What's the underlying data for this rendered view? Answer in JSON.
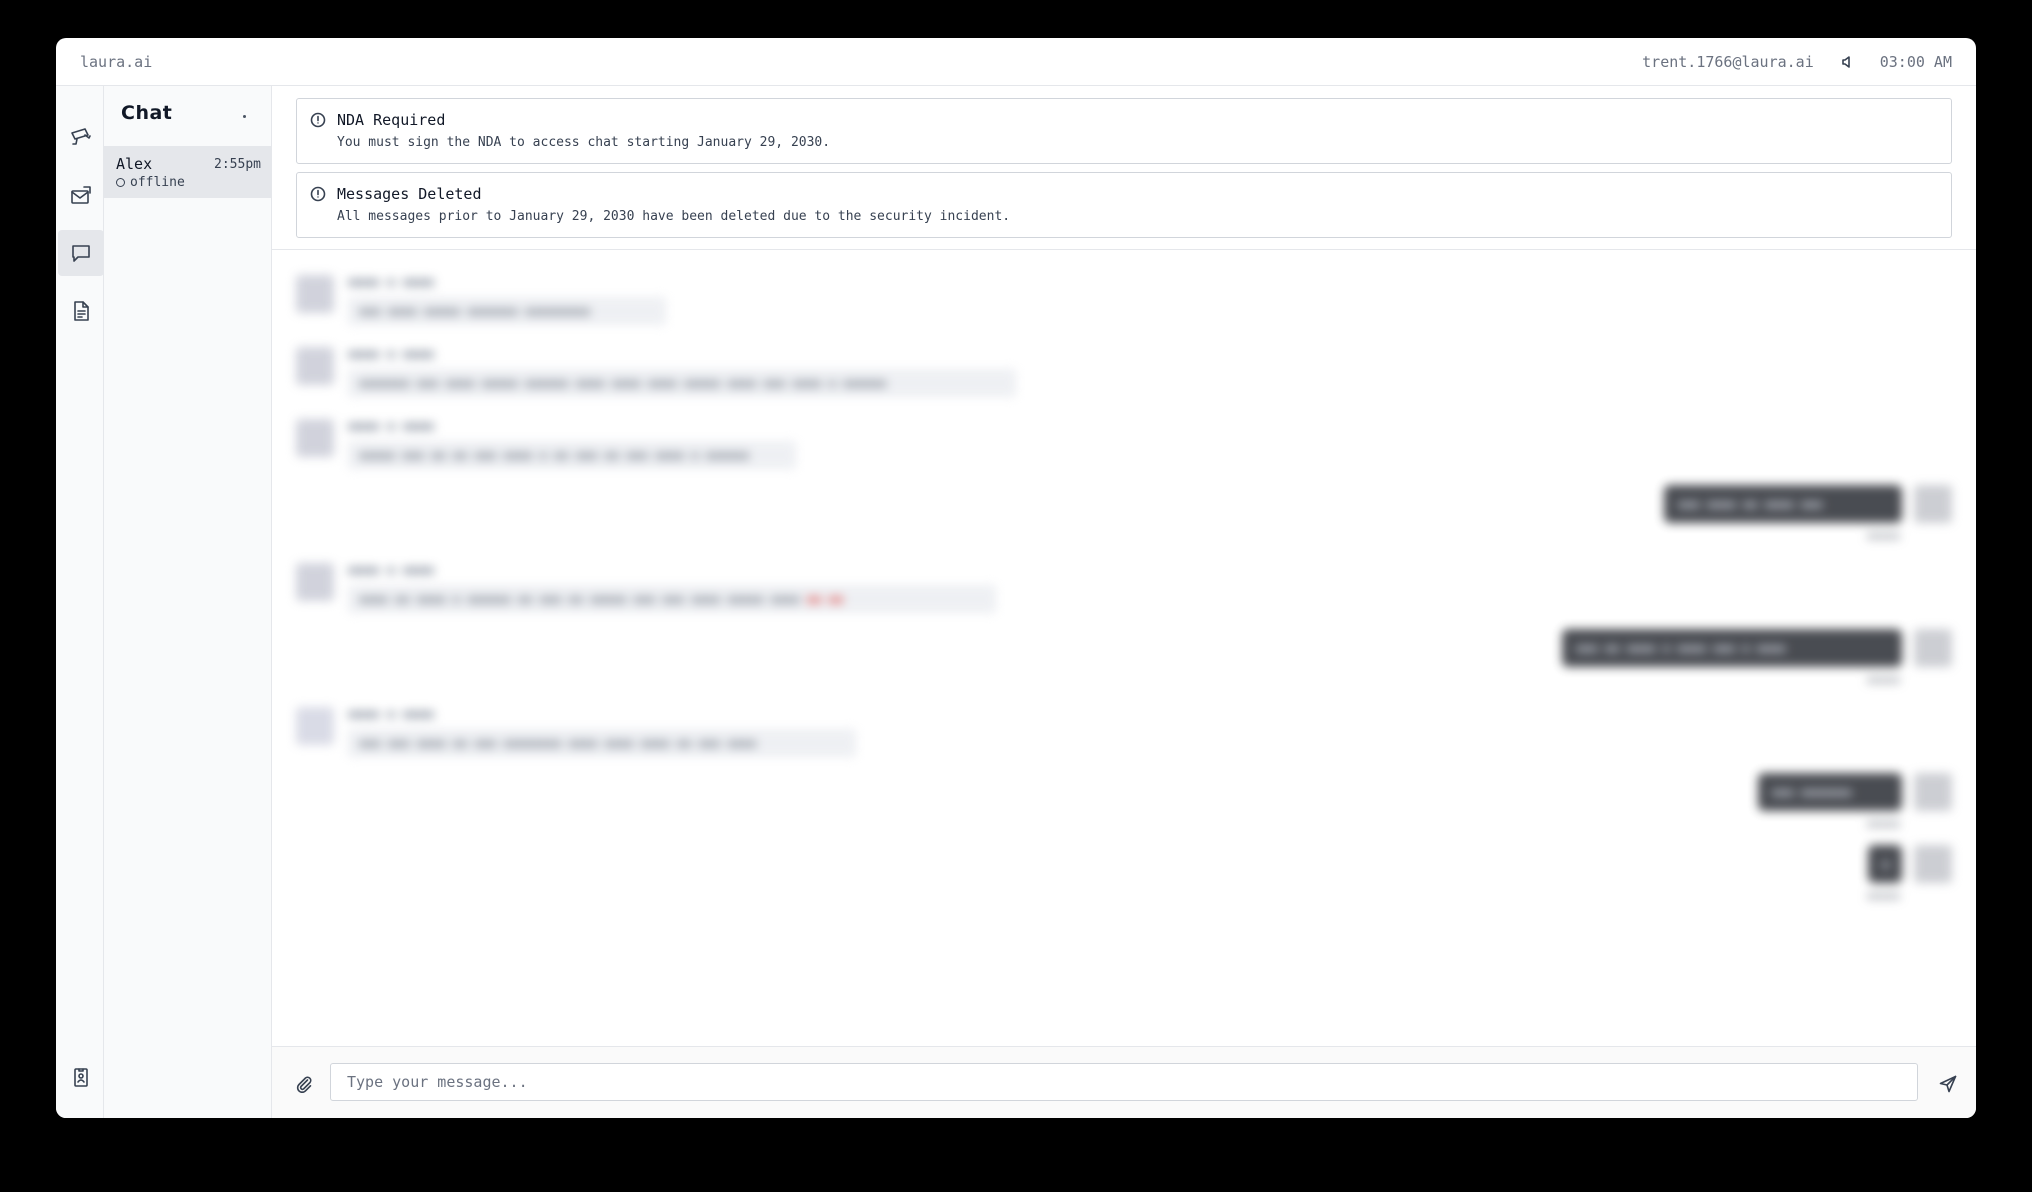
{
  "app": {
    "brand": "laura.ai",
    "user_email": "trent.1766@laura.ai",
    "clock": "03:00 AM"
  },
  "rail": {
    "items": [
      {
        "icon": "camera-icon"
      },
      {
        "icon": "mail-icon"
      },
      {
        "icon": "chat-icon",
        "active": true
      },
      {
        "icon": "document-icon"
      }
    ],
    "footer_icon": "badge-icon"
  },
  "contacts": {
    "title": "Chat",
    "items": [
      {
        "name": "Alex",
        "time": "2:55pm",
        "status": "offline"
      }
    ]
  },
  "notices": [
    {
      "title": "NDA Required",
      "body": "You must sign the NDA to access chat starting January 29, 2030."
    },
    {
      "title": "Messages Deleted",
      "body": "All messages prior to January 29, 2030 have been deleted due to the security incident."
    }
  ],
  "composer": {
    "placeholder": "Type your message..."
  }
}
